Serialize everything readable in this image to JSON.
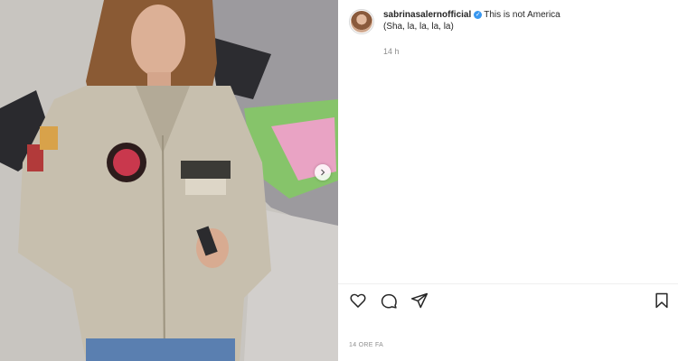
{
  "post": {
    "username": "sabrinasalernofficial",
    "verified": true,
    "caption_line1": "This is not America",
    "caption_line2": "(Sha, la, la, la, la)",
    "relative_time": "14 h",
    "posted_ago": "14 ORE FA"
  },
  "icons": {
    "verified": "verified-badge-icon",
    "like": "heart-icon",
    "comment": "comment-bubble-icon",
    "share": "paper-plane-icon",
    "save": "bookmark-icon",
    "next": "chevron-right-icon"
  },
  "colors": {
    "verified": "#3897f0",
    "text": "#262626",
    "muted": "#8e8e8e"
  }
}
